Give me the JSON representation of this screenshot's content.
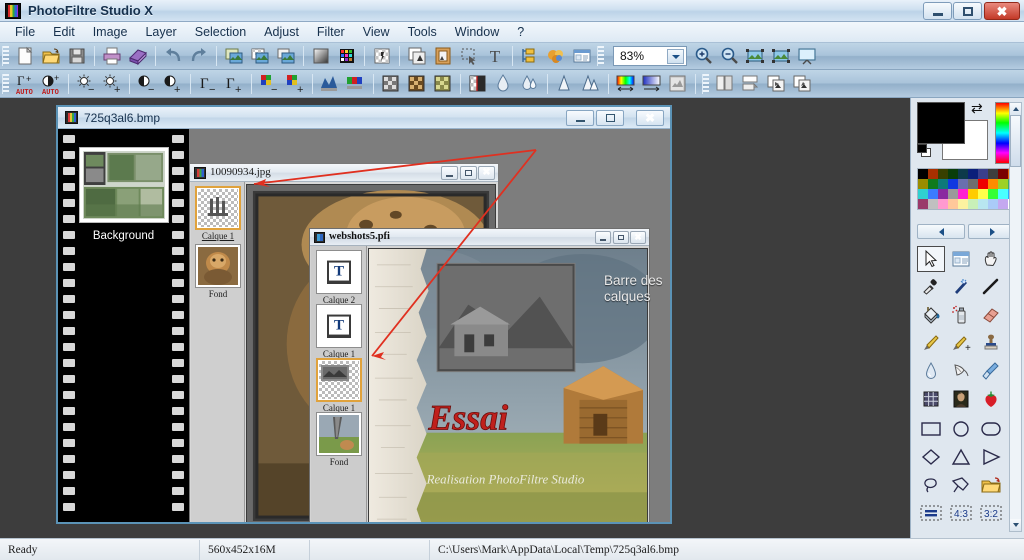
{
  "app": {
    "title": "PhotoFiltre Studio X",
    "icon": "photofiltre-film-icon"
  },
  "titlebar_buttons": {
    "minimize": "minimize-icon",
    "maximize": "maximize-icon",
    "close": "✖"
  },
  "menubar": {
    "items": [
      {
        "label": "File"
      },
      {
        "label": "Edit"
      },
      {
        "label": "Image"
      },
      {
        "label": "Layer"
      },
      {
        "label": "Selection"
      },
      {
        "label": "Adjust"
      },
      {
        "label": "Filter"
      },
      {
        "label": "View"
      },
      {
        "label": "Tools"
      },
      {
        "label": "Window"
      },
      {
        "label": "?"
      }
    ]
  },
  "toolbar1": {
    "zoom_value": "83%",
    "buttons": [
      {
        "name": "new-file-icon",
        "tip": "New"
      },
      {
        "name": "open-file-icon",
        "tip": "Open"
      },
      {
        "name": "save-file-icon",
        "tip": "Save"
      },
      {
        "name": "print-icon",
        "tip": "Print"
      },
      {
        "name": "scan-icon",
        "tip": "Scan"
      },
      {
        "name": "undo-icon",
        "tip": "Undo"
      },
      {
        "name": "redo-icon",
        "tip": "Redo"
      },
      {
        "name": "copy-image-icon",
        "tip": "Copy"
      },
      {
        "name": "paste-transparent-icon",
        "tip": "Paste as transparent"
      },
      {
        "name": "duplicate-image-icon",
        "tip": "Duplicate"
      },
      {
        "name": "gradient-icon",
        "tip": "Gradient"
      },
      {
        "name": "color-palette-icon",
        "tip": "Palette"
      },
      {
        "name": "transparency-icon",
        "tip": "Transparency"
      },
      {
        "name": "layer-duplicate-icon",
        "tip": "Duplicate layer"
      },
      {
        "name": "frame-icon",
        "tip": "Frame"
      },
      {
        "name": "selection-icon",
        "tip": "Selection"
      },
      {
        "name": "text-tool-icon",
        "tip": "Text"
      },
      {
        "name": "layers-manager-icon",
        "tip": "Layers manager"
      },
      {
        "name": "effects-icon",
        "tip": "Effects"
      },
      {
        "name": "module-icon",
        "tip": "Module"
      }
    ],
    "zoom_buttons": [
      {
        "name": "zoom-in-icon",
        "tip": "Zoom in"
      },
      {
        "name": "zoom-out-icon",
        "tip": "Zoom out"
      },
      {
        "name": "fit-image-icon",
        "tip": "Fit to screen"
      },
      {
        "name": "actual-size-icon",
        "tip": "Actual size"
      },
      {
        "name": "slideshow-icon",
        "tip": "Slideshow"
      }
    ]
  },
  "toolbar2": {
    "buttons": [
      {
        "name": "auto-levels-icon",
        "tip": "Auto levels"
      },
      {
        "name": "auto-contrast-icon",
        "tip": "Auto contrast"
      },
      {
        "name": "brightness-down-icon",
        "tip": "Brightness -"
      },
      {
        "name": "brightness-up-icon",
        "tip": "Brightness +"
      },
      {
        "name": "contrast-down-icon",
        "tip": "Contrast -"
      },
      {
        "name": "contrast-up-icon",
        "tip": "Contrast +"
      },
      {
        "name": "gamma-down-icon",
        "tip": "Gamma -"
      },
      {
        "name": "gamma-up-icon",
        "tip": "Gamma +"
      },
      {
        "name": "saturation-down-icon",
        "tip": "Saturation -"
      },
      {
        "name": "saturation-up-icon",
        "tip": "Saturation +"
      },
      {
        "name": "histogram-icon",
        "tip": "Histogram"
      },
      {
        "name": "color-balance-icon",
        "tip": "Color balance"
      },
      {
        "name": "grayscale-icon",
        "tip": "Grayscale"
      },
      {
        "name": "sepia-icon",
        "tip": "Sepia"
      },
      {
        "name": "duotone-icon",
        "tip": "Duotone"
      },
      {
        "name": "negative-icon",
        "tip": "Negative"
      },
      {
        "name": "blur-icon",
        "tip": "Blur"
      },
      {
        "name": "blur-more-icon",
        "tip": "Blur more"
      },
      {
        "name": "sharpen-icon",
        "tip": "Sharpen"
      },
      {
        "name": "sharpen-more-icon",
        "tip": "Sharpen more"
      },
      {
        "name": "hue-shift-icon",
        "tip": "Hue"
      },
      {
        "name": "colorize-icon",
        "tip": "Colorize"
      },
      {
        "name": "texture-icon",
        "tip": "Texture"
      },
      {
        "name": "split-view-icon",
        "tip": "Split view"
      },
      {
        "name": "page-setup-icon",
        "tip": "Page setup"
      },
      {
        "name": "flip-horizontal-icon",
        "tip": "Flip horizontal"
      },
      {
        "name": "flip-vertical-icon",
        "tip": "Flip vertical"
      }
    ]
  },
  "windows": {
    "bmp": {
      "title": "725q3al6.bmp",
      "filmstrip_label": "Background"
    },
    "jpg": {
      "title": "10090934.jpg",
      "layers": [
        {
          "label": "Calque 1",
          "type": "checker",
          "selected": true
        },
        {
          "label": "Fond",
          "type": "photo-cat",
          "selected": false
        }
      ]
    },
    "pfi": {
      "title": "webshots5.pfi",
      "layers": [
        {
          "label": "Calque 2",
          "type": "text",
          "selected": false
        },
        {
          "label": "Calque 1",
          "type": "text",
          "selected": false
        },
        {
          "label": "Calque 1",
          "type": "image-checker",
          "selected": true
        },
        {
          "label": "Fond",
          "type": "photo-tornado",
          "selected": false
        }
      ],
      "canvas_text": {
        "essai": "Essai",
        "subtitle": "Realisation PhotoFiltre Studio"
      }
    }
  },
  "annotation": {
    "text_line1": "Barre des",
    "text_line2": "calques",
    "arrow_color": "#e03020"
  },
  "palette": {
    "foreground_color": "#000000",
    "background_color": "#ffffff",
    "swap_icon": "swap-colors-icon",
    "prev_label": "prev-palette-arrow",
    "next_label": "next-palette-arrow",
    "grid_colors": [
      "#000000",
      "#a83000",
      "#384000",
      "#0a3d0a",
      "#0d3a4a",
      "#0b1f7a",
      "#3a3f8c",
      "#3e3e3e",
      "#7a0000",
      "#e06000",
      "#9a8c00",
      "#0f7a1e",
      "#0e7a7a",
      "#1038e0",
      "#6a6fae",
      "#6e6e6e",
      "#ee0000",
      "#ff8c00",
      "#9ed126",
      "#3fa86a",
      "#2fd0d0",
      "#3a7cff",
      "#8a2aa0",
      "#9a9a9a",
      "#ff20d0",
      "#ffcc00",
      "#ffff4a",
      "#35ff35",
      "#4affff",
      "#2aa8ff",
      "#9a3a6a",
      "#c0c0c0",
      "#ff9ad0",
      "#ffc89a",
      "#fcf2a0",
      "#c8f0b8",
      "#b8e6f0",
      "#aacbf8",
      "#c4a8f0",
      "#ffffff"
    ],
    "tools": [
      {
        "name": "pointer-tool-icon",
        "label": "Selection pointer",
        "selected": true
      },
      {
        "name": "toolbar-panel-icon",
        "label": "Tool options"
      },
      {
        "name": "hand-tool-icon",
        "label": "Hand"
      },
      {
        "name": "eyedropper-tool-icon",
        "label": "Color picker"
      },
      {
        "name": "magic-wand-tool-icon",
        "label": "Magic wand"
      },
      {
        "name": "line-tool-icon",
        "label": "Line"
      },
      {
        "name": "paint-bucket-tool-icon",
        "label": "Fill"
      },
      {
        "name": "spray-tool-icon",
        "label": "Airbrush"
      },
      {
        "name": "eraser-tool-icon",
        "label": "Eraser"
      },
      {
        "name": "paintbrush-tool-icon",
        "label": "Paintbrush"
      },
      {
        "name": "advanced-brush-tool-icon",
        "label": "Advanced brush"
      },
      {
        "name": "clone-stamp-tool-icon",
        "label": "Clone stamp"
      },
      {
        "name": "blur-tool-icon",
        "label": "Blur / water drop"
      },
      {
        "name": "smudge-tool-icon",
        "label": "Smudge"
      },
      {
        "name": "broom-tool-icon",
        "label": "Clean"
      },
      {
        "name": "grid-tool-icon",
        "label": "Grid"
      },
      {
        "name": "portrait-tool-icon",
        "label": "Portrait retouch"
      },
      {
        "name": "strawberry-tool-icon",
        "label": "Red eye / color"
      }
    ],
    "shapes": [
      {
        "name": "rectangle-shape-icon",
        "label": "Rectangle"
      },
      {
        "name": "ellipse-shape-icon",
        "label": "Ellipse"
      },
      {
        "name": "rounded-rectangle-shape-icon",
        "label": "Rounded rectangle"
      },
      {
        "name": "diamond-shape-icon",
        "label": "Diamond"
      },
      {
        "name": "triangle-shape-icon",
        "label": "Triangle"
      },
      {
        "name": "right-triangle-shape-icon",
        "label": "Right triangle"
      },
      {
        "name": "lasso-shape-icon",
        "label": "Lasso"
      },
      {
        "name": "polygon-shape-icon",
        "label": "Polygon"
      },
      {
        "name": "load-shape-icon",
        "label": "Load shape"
      },
      {
        "name": "ratio-free-icon",
        "label": "Free ratio"
      },
      {
        "name": "ratio-4-3-icon",
        "label": "4:3"
      },
      {
        "name": "ratio-3-2-icon",
        "label": "3:2"
      }
    ],
    "ratio_labels": {
      "r43": "4:3",
      "r32": "3:2"
    }
  },
  "statusbar": {
    "status": "Ready",
    "dimensions": "560x452x16M",
    "blank": "",
    "path": "C:\\Users\\Mark\\AppData\\Local\\Temp\\725q3al6.bmp"
  }
}
